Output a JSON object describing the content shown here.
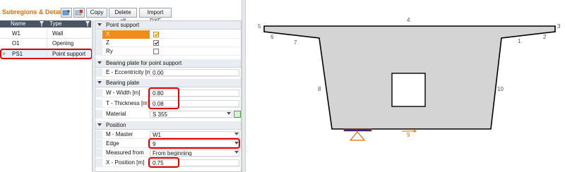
{
  "panel": {
    "title": "Subregions & Details",
    "buttons": {
      "copy": "Copy",
      "delete_all": "Delete all",
      "import_dxf": "Import DXF"
    },
    "icons": {
      "add": "add-icon",
      "delete": "delete-icon"
    }
  },
  "subregions": {
    "headers": {
      "name": "Name",
      "type": "Type"
    },
    "rows": [
      {
        "name": "W1",
        "type": "Wall"
      },
      {
        "name": "O1",
        "type": "Opening"
      },
      {
        "name": "PS1",
        "type": "Point support",
        "marker": ">"
      }
    ]
  },
  "properties": {
    "point_support": {
      "label": "Point support",
      "x": {
        "label": "X",
        "checked": true
      },
      "z": {
        "label": "Z",
        "checked": true
      },
      "ry": {
        "label": "Ry",
        "checked": false
      }
    },
    "bearing_plate_point": {
      "label": "Bearing plate for point support",
      "eccentricity": {
        "label": "E - Eccentricity [m]",
        "value": "0.00"
      }
    },
    "bearing_plate": {
      "label": "Bearing plate",
      "width": {
        "label": "W - Width [m]",
        "value": "0.80"
      },
      "thickness": {
        "label": "T - Thickness [m]",
        "value": "0.08"
      },
      "material": {
        "label": "Material",
        "value": "S 355"
      }
    },
    "position": {
      "label": "Position",
      "master": {
        "label": "M - Master",
        "value": "W1"
      },
      "edge": {
        "label": "Edge",
        "value": "9"
      },
      "measured_from": {
        "label": "Measured from",
        "value": "From beginning"
      },
      "x_position": {
        "label": "X - Position [m]",
        "value": "0.75"
      }
    }
  },
  "drawing": {
    "edges": [
      "1",
      "2",
      "3",
      "4",
      "5",
      "6",
      "7",
      "8",
      "9",
      "10"
    ],
    "colors": {
      "fill": "#d4d4d4",
      "outline": "#000000",
      "support": "#e06a00",
      "accent": "#e07000"
    }
  }
}
